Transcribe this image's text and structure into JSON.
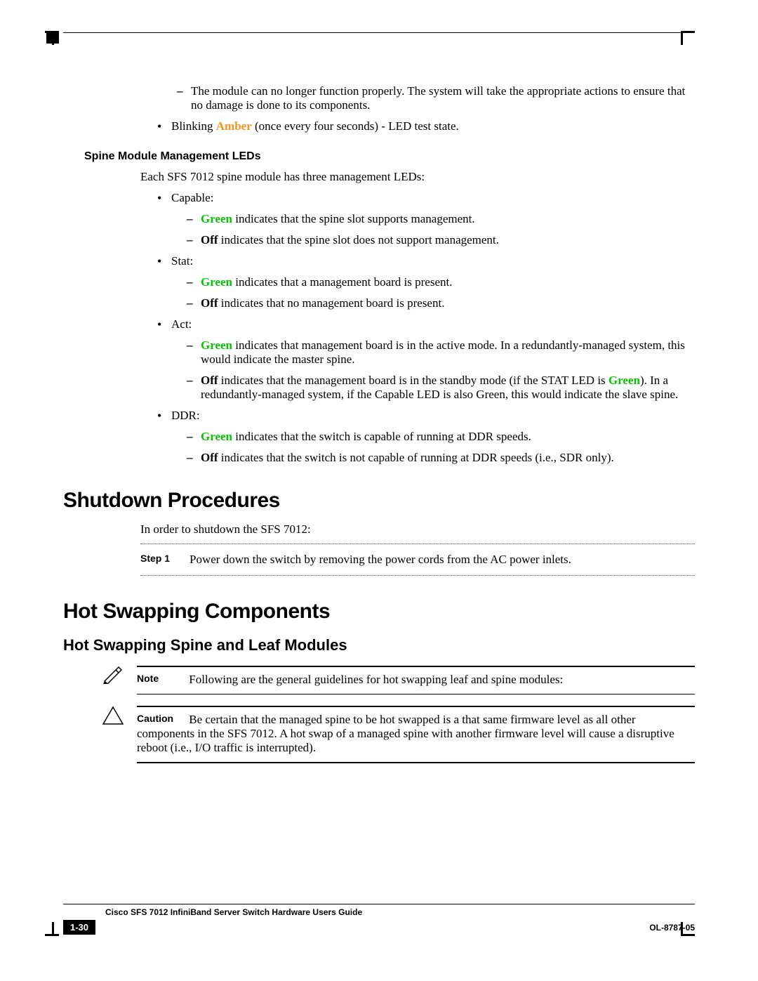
{
  "top_list": {
    "module_fail": "The module can no longer function properly. The system will take the appropriate actions to ensure that no damage is done to its components.",
    "blinking_prefix": "Blinking ",
    "blinking_amber": "Amber",
    "blinking_suffix": " (once every four seconds) - LED test state."
  },
  "spine_leds": {
    "heading": "Spine Module Management LEDs",
    "intro": "Each SFS 7012 spine module has three management LEDs:",
    "capable_label": "Capable:",
    "capable_green": " indicates that the spine slot supports management.",
    "capable_off_label": "Off",
    "capable_off": " indicates that the spine slot does not support management.",
    "stat_label": "Stat:",
    "stat_green": " indicates that a management board is present.",
    "stat_off_label": "Off",
    "stat_off": " indicates that no management board is present.",
    "act_label": "Act:",
    "act_green": " indicates that management board is in the active mode. In a redundantly-managed system, this would indicate the master spine.",
    "act_off_label": "Off",
    "act_off_1": " indicates that the management board is in the standby mode (if the STAT LED is ",
    "act_off_green2": "Green",
    "act_off_2": "). In a redundantly-managed system, if the Capable LED is also Green, this would indicate the slave spine.",
    "ddr_label": "DDR:",
    "ddr_green": " indicates that the switch is capable of running at DDR speeds.",
    "ddr_off_label": "Off",
    "ddr_off": " indicates that the switch is not capable of running at DDR speeds (i.e., SDR only).",
    "green_word": "Green"
  },
  "shutdown": {
    "heading": "Shutdown Procedures",
    "intro": "In order to shutdown the SFS 7012:",
    "step1_label": "Step 1",
    "step1_text": "Power down the switch by removing the power cords from the AC power inlets."
  },
  "hotswap": {
    "heading": "Hot Swapping Components",
    "subheading": "Hot Swapping Spine and Leaf Modules",
    "note_label": "Note",
    "note_text": "Following are the general guidelines for hot swapping leaf and spine modules:",
    "caution_label": "Caution",
    "caution_text": "Be certain that the managed spine to be hot swapped is a that same firmware level as all other components in the SFS 7012. A hot swap of a managed spine with another firmware level will cause a disruptive reboot (i.e., I/O traffic is interrupted)."
  },
  "footer": {
    "title": "Cisco SFS 7012 InfiniBand Server Switch Hardware Users Guide",
    "page": "1-30",
    "doc": "OL-8787-05"
  }
}
